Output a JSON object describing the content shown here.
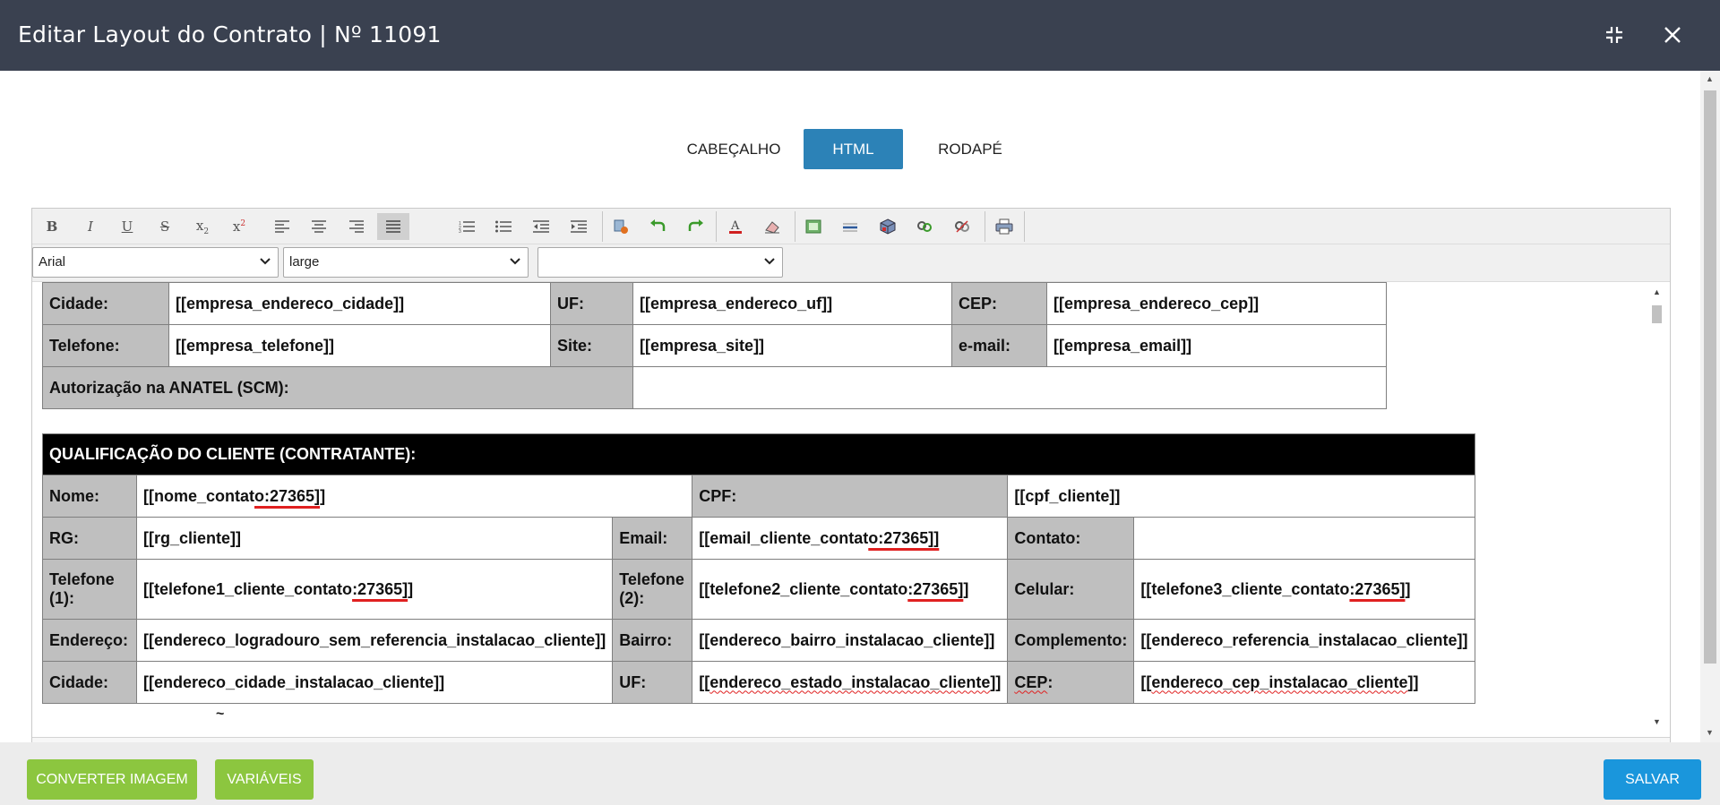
{
  "window": {
    "title": "Editar Layout do Contrato | Nº 11091"
  },
  "tabs": [
    {
      "label": "CABEÇALHO",
      "active": false
    },
    {
      "label": "HTML",
      "active": true
    },
    {
      "label": "RODAPÉ",
      "active": false
    }
  ],
  "toolbar": {
    "buttons": [
      "bold",
      "italic",
      "underline",
      "strikethrough",
      "subscript",
      "superscript",
      "align-left",
      "align-center",
      "align-right",
      "align-justify",
      "ordered-list",
      "unordered-list",
      "outdent",
      "indent",
      "paste-special",
      "undo",
      "redo",
      "text-color",
      "clear-format",
      "insert-image",
      "horizontal-rule",
      "insert-object",
      "link",
      "unlink",
      "print"
    ],
    "font_family": "Arial",
    "font_size": "large",
    "format": ""
  },
  "company_table": {
    "rows": [
      [
        {
          "text": "Cidade:",
          "label": true
        },
        {
          "text": "[[empresa_endereco_cidade]]"
        },
        {
          "text": "UF:",
          "label": true
        },
        {
          "text": "[[empresa_endereco_uf]]"
        },
        {
          "text": "CEP:",
          "label": true
        },
        {
          "text": "[[empresa_endereco_cep]]"
        }
      ],
      [
        {
          "text": "Telefone:",
          "label": true
        },
        {
          "text": "[[empresa_telefone]]"
        },
        {
          "text": "Site:",
          "label": true
        },
        {
          "text": "[[empresa_site]]"
        },
        {
          "text": "e-mail:",
          "label": true
        },
        {
          "text": "[[empresa_email]]"
        }
      ],
      [
        {
          "text": "Autorização na ANATEL (SCM):",
          "label": true
        },
        {
          "text": ""
        }
      ]
    ]
  },
  "client_section": {
    "heading": "QUALIFICAÇÃO DO CLIENTE (CONTRATANTE):",
    "nome_label": "Nome:",
    "nome_pre": "[[nome_contat",
    "nome_ul": "o:27365]",
    "nome_post": "]",
    "cpf_label": "CPF:",
    "cpf_value": "[[cpf_cliente]]",
    "rg_label": "RG:",
    "rg_value": "[[rg_cliente]]",
    "email_label": "Email:",
    "email_pre": "[[email_cliente_contat",
    "email_ul": "o:27365]]",
    "email_post": "",
    "contato_label": "Contato:",
    "tel1_label": "Telefone (1):",
    "tel1_pre": "[[telefone1_cliente_contato",
    "tel1_ul": ":27365]",
    "tel1_post": "]",
    "tel2_label": "Telefone (2):",
    "tel2_pre": "[[telefone2_cliente_contato",
    "tel2_ul": ":27365]",
    "tel2_post": "]",
    "cel_label": "Celular:",
    "cel_pre": "[[telefone3_cliente_contato",
    "cel_ul": ":27365]",
    "cel_post": "]",
    "endereco_label": "Endereço:",
    "endereco_value": "[[endereco_logradouro_sem_referencia_instalacao_cliente]]",
    "bairro_label": "Bairro:",
    "bairro_value": "[[endereco_bairro_instalacao_cliente]]",
    "complemento_label": "Complemento:",
    "complemento_value": "[[endereco_referencia_instalacao_cliente]]",
    "cidade_label": "Cidade:",
    "cidade_value": "[[endereco_cidade_instalacao_cliente]]",
    "uf_label": "UF:",
    "uf_pre": "[[",
    "uf_wavy": "endereco_estado_instalacao_cliente",
    "uf_post": "]]",
    "cep_label_wavy": "CEP",
    "cep_label_post": ":",
    "cep_pre": "[[",
    "cep_wavy": "endereco_cep_instalacao_cliente",
    "cep_post": "]]",
    "trailing": "~"
  },
  "footer": {
    "convert_label": "CONVERTER IMAGEM",
    "variables_label": "VARIÁVEIS",
    "save_label": "SALVAR"
  },
  "colors": {
    "titlebar": "#3a4150",
    "tab_active": "#2c82b7",
    "label_cell": "#bfbfbf",
    "btn_green": "#8cc63f",
    "btn_blue": "#1a96dc",
    "spell_underline": "#e02020"
  }
}
